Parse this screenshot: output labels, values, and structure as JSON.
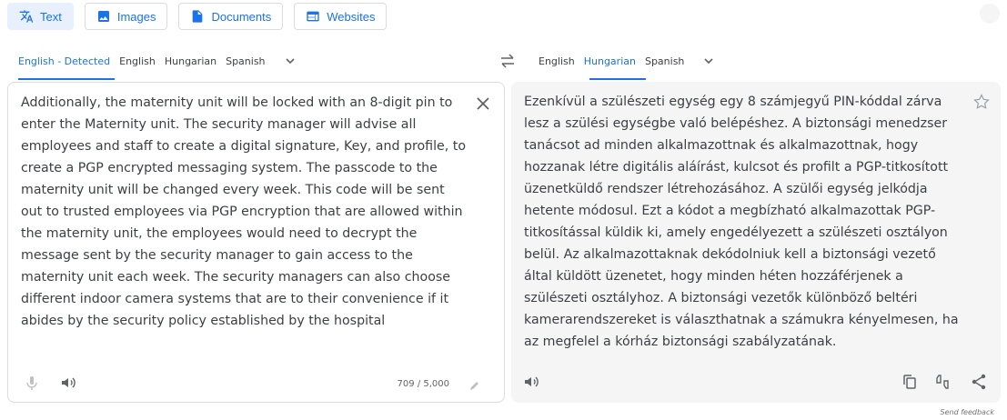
{
  "modes": [
    {
      "label": "Text",
      "icon": "translate-icon",
      "active": true
    },
    {
      "label": "Images",
      "icon": "image-icon",
      "active": false
    },
    {
      "label": "Documents",
      "icon": "document-icon",
      "active": false
    },
    {
      "label": "Websites",
      "icon": "website-icon",
      "active": false
    }
  ],
  "source": {
    "languages": [
      "English - Detected",
      "English",
      "Hungarian",
      "Spanish"
    ],
    "active_index": 0,
    "text": "Additionally, the maternity unit will be locked with an 8-digit pin to enter the Maternity unit. The security manager will advise all employees and staff to create a digital signature, Key, and profile, to create a PGP encrypted messaging system. The passcode to the maternity unit will be changed every week. This code will be sent out to trusted employees via PGP encryption that are allowed within the maternity unit, the employees would need to decrypt the message sent by the security manager to gain access to the maternity unit each week. The security managers can also choose different indoor camera systems that are to their convenience if it abides by the security policy established by the hospital",
    "char_count": "709 / 5,000"
  },
  "target": {
    "languages": [
      "English",
      "Hungarian",
      "Spanish"
    ],
    "active_index": 1,
    "text": "Ezenkívül a szülészeti egység egy 8 számjegyű PIN-kóddal zárva lesz a szülési egységbe való belépéshez. A biztonsági menedzser tanácsot ad minden alkalmazottnak és alkalmazottnak, hogy hozzanak létre digitális aláírást, kulcsot és profilt a PGP-titkosított üzenetküldő rendszer létrehozásához. A szülői egység jelkódja hetente módosul. Ezt a kódot a megbízható alkalmazottak PGP-titkosítással küldik ki, amely engedélyezett a szülészeti osztályon belül. Az alkalmazottaknak dekódolniuk kell a biztonsági vezető által küldött üzenetet, hogy minden héten hozzáférjenek a szülészeti osztályhoz. A biztonsági vezetők különböző beltéri kamerarendszereket is választhatnak a számukra kényelmesen, ha az megfelel a kórház biztonsági szabályzatának."
  },
  "feedback_label": "Send feedback",
  "colors": {
    "accent": "#1a73e8",
    "text": "#3c4043",
    "icon": "#5f6368",
    "output_bg": "#f5f5f5"
  }
}
